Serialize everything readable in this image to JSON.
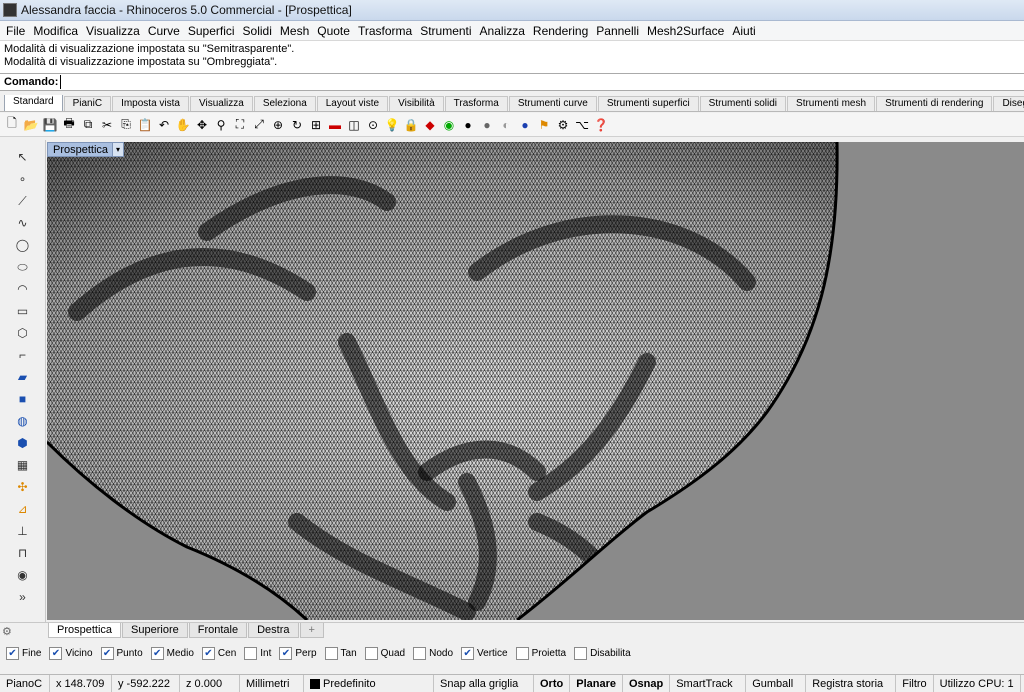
{
  "window": {
    "title": "Alessandra faccia - Rhinoceros 5.0 Commercial - [Prospettica]"
  },
  "menu": [
    "File",
    "Modifica",
    "Visualizza",
    "Curve",
    "Superfici",
    "Solidi",
    "Mesh",
    "Quote",
    "Trasforma",
    "Strumenti",
    "Analizza",
    "Rendering",
    "Pannelli",
    "Mesh2Surface",
    "Aiuti"
  ],
  "history": [
    "Modalità di visualizzazione impostata su \"Semitrasparente\".",
    "Modalità di visualizzazione impostata su \"Ombreggiata\"."
  ],
  "command": {
    "label": "Comando:",
    "value": ""
  },
  "toolbar_tabs": [
    "Standard",
    "PianiC",
    "Imposta vista",
    "Visualizza",
    "Seleziona",
    "Layout viste",
    "Visibilità",
    "Trasforma",
    "Strumenti curve",
    "Strumenti superfici",
    "Strumenti solidi",
    "Strumenti mesh",
    "Strumenti di rendering",
    "Disegno tecnico"
  ],
  "toolbar_icons": [
    "new-file-icon",
    "open-folder-icon",
    "save-icon",
    "print-icon",
    "import-icon",
    "cut-icon",
    "copy-icon",
    "paste-icon",
    "undo-icon",
    "pan-hand-icon",
    "rotate-view-icon",
    "zoom-icon",
    "zoom-window-icon",
    "zoom-extents-icon",
    "zoom-selected-icon",
    "refresh-view-icon",
    "four-viewports-icon",
    "car-icon",
    "layer-icon",
    "properties-icon",
    "lightbulb-icon",
    "lock-icon",
    "material-icon",
    "render-preview-icon",
    "sphere-icon",
    "shaded-sphere-icon",
    "ghosted-sphere-icon",
    "rendered-sphere-icon",
    "flag-icon",
    "settings-gear-icon",
    "grasshopper-icon",
    "help-icon"
  ],
  "sidebar_icons": [
    "select-arrow-icon",
    "point-icon",
    "polyline-icon",
    "curve-icon",
    "circle-icon",
    "ellipse-icon",
    "arc-icon",
    "rectangle-icon",
    "polygon-icon",
    "fillet-curve-icon",
    "surface-icon",
    "box-solid-icon",
    "boolean-icon",
    "extrude-icon",
    "mesh-icon",
    "transform-icon",
    "gumball-icon",
    "dimension-icon",
    "analyze-icon",
    "render-icon",
    "more-icon"
  ],
  "viewport": {
    "label": "Prospettica",
    "background": "#8a8a8a",
    "mesh_color": "#e0e0e0"
  },
  "viewport_tabs": [
    "Prospettica",
    "Superiore",
    "Frontale",
    "Destra",
    "+"
  ],
  "osnaps": [
    {
      "label": "Fine",
      "checked": true
    },
    {
      "label": "Vicino",
      "checked": true
    },
    {
      "label": "Punto",
      "checked": true
    },
    {
      "label": "Medio",
      "checked": true
    },
    {
      "label": "Cen",
      "checked": true
    },
    {
      "label": "Int",
      "checked": false
    },
    {
      "label": "Perp",
      "checked": true
    },
    {
      "label": "Tan",
      "checked": false
    },
    {
      "label": "Quad",
      "checked": false
    },
    {
      "label": "Nodo",
      "checked": false
    },
    {
      "label": "Vertice",
      "checked": true
    },
    {
      "label": "Proietta",
      "checked": false
    },
    {
      "label": "Disabilita",
      "checked": false
    }
  ],
  "status": {
    "plane": "PianoC",
    "x": "x 148.709",
    "y": "y -592.222",
    "z": "z 0.000",
    "units": "Millimetri",
    "layer": "Predefinito",
    "grid_snap": "Snap alla griglia",
    "ortho": "Orto",
    "planar": "Planare",
    "osnap": "Osnap",
    "smarttrack": "SmartTrack",
    "gumball": "Gumball",
    "history": "Registra storia",
    "filter": "Filtro",
    "cpu": "Utilizzo CPU: 1"
  }
}
